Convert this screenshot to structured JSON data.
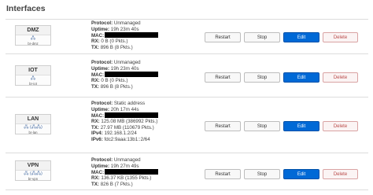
{
  "section_title": "Interfaces",
  "labels": {
    "protocol": "Protocol:",
    "uptime": "Uptime:",
    "mac": "MAC:",
    "rx": "RX:",
    "tx": "TX:",
    "ipv4": "IPv4:",
    "ipv6": "IPv6:"
  },
  "buttons": {
    "restart": "Restart",
    "stop": "Stop",
    "edit": "Edit",
    "delete": "Delete"
  },
  "interfaces": [
    {
      "name": "DMZ",
      "icons": "🖧",
      "device": "br-dmz",
      "protocol": "Unmanaged",
      "uptime": "19h 23m 40s",
      "rx": "0 B (0 Pkts.)",
      "tx": "896 B (8 Pkts.)"
    },
    {
      "name": "IOT",
      "icons": "🖧",
      "device": "br-iot",
      "protocol": "Unmanaged",
      "uptime": "19h 23m 40s",
      "rx": "0 B (0 Pkts.)",
      "tx": "896 B (8 Pkts.)"
    },
    {
      "name": "LAN",
      "icons": "🖧 (🖧🖧)",
      "device": "br-lan",
      "protocol": "Static address",
      "uptime": "20h 17m 44s",
      "rx": "125.08 MB (386992 Pkts.)",
      "tx": "27.97 MB (110679 Pkts.)",
      "ipv4": "192.168.1.2/24",
      "ipv6": "fdc2:9aaa:13b1::2/64"
    },
    {
      "name": "VPN",
      "icons": "🖧 (🖧🖧)",
      "device": "br-vpn",
      "protocol": "Unmanaged",
      "uptime": "19h 27m 49s",
      "rx": "136.37 KB (1355 Pkts.)",
      "tx": "826 B (7 Pkts.)"
    }
  ],
  "colors": {
    "edit_button": "#0069d6",
    "delete_text": "#b94a48",
    "mac_redaction": "#000000"
  }
}
